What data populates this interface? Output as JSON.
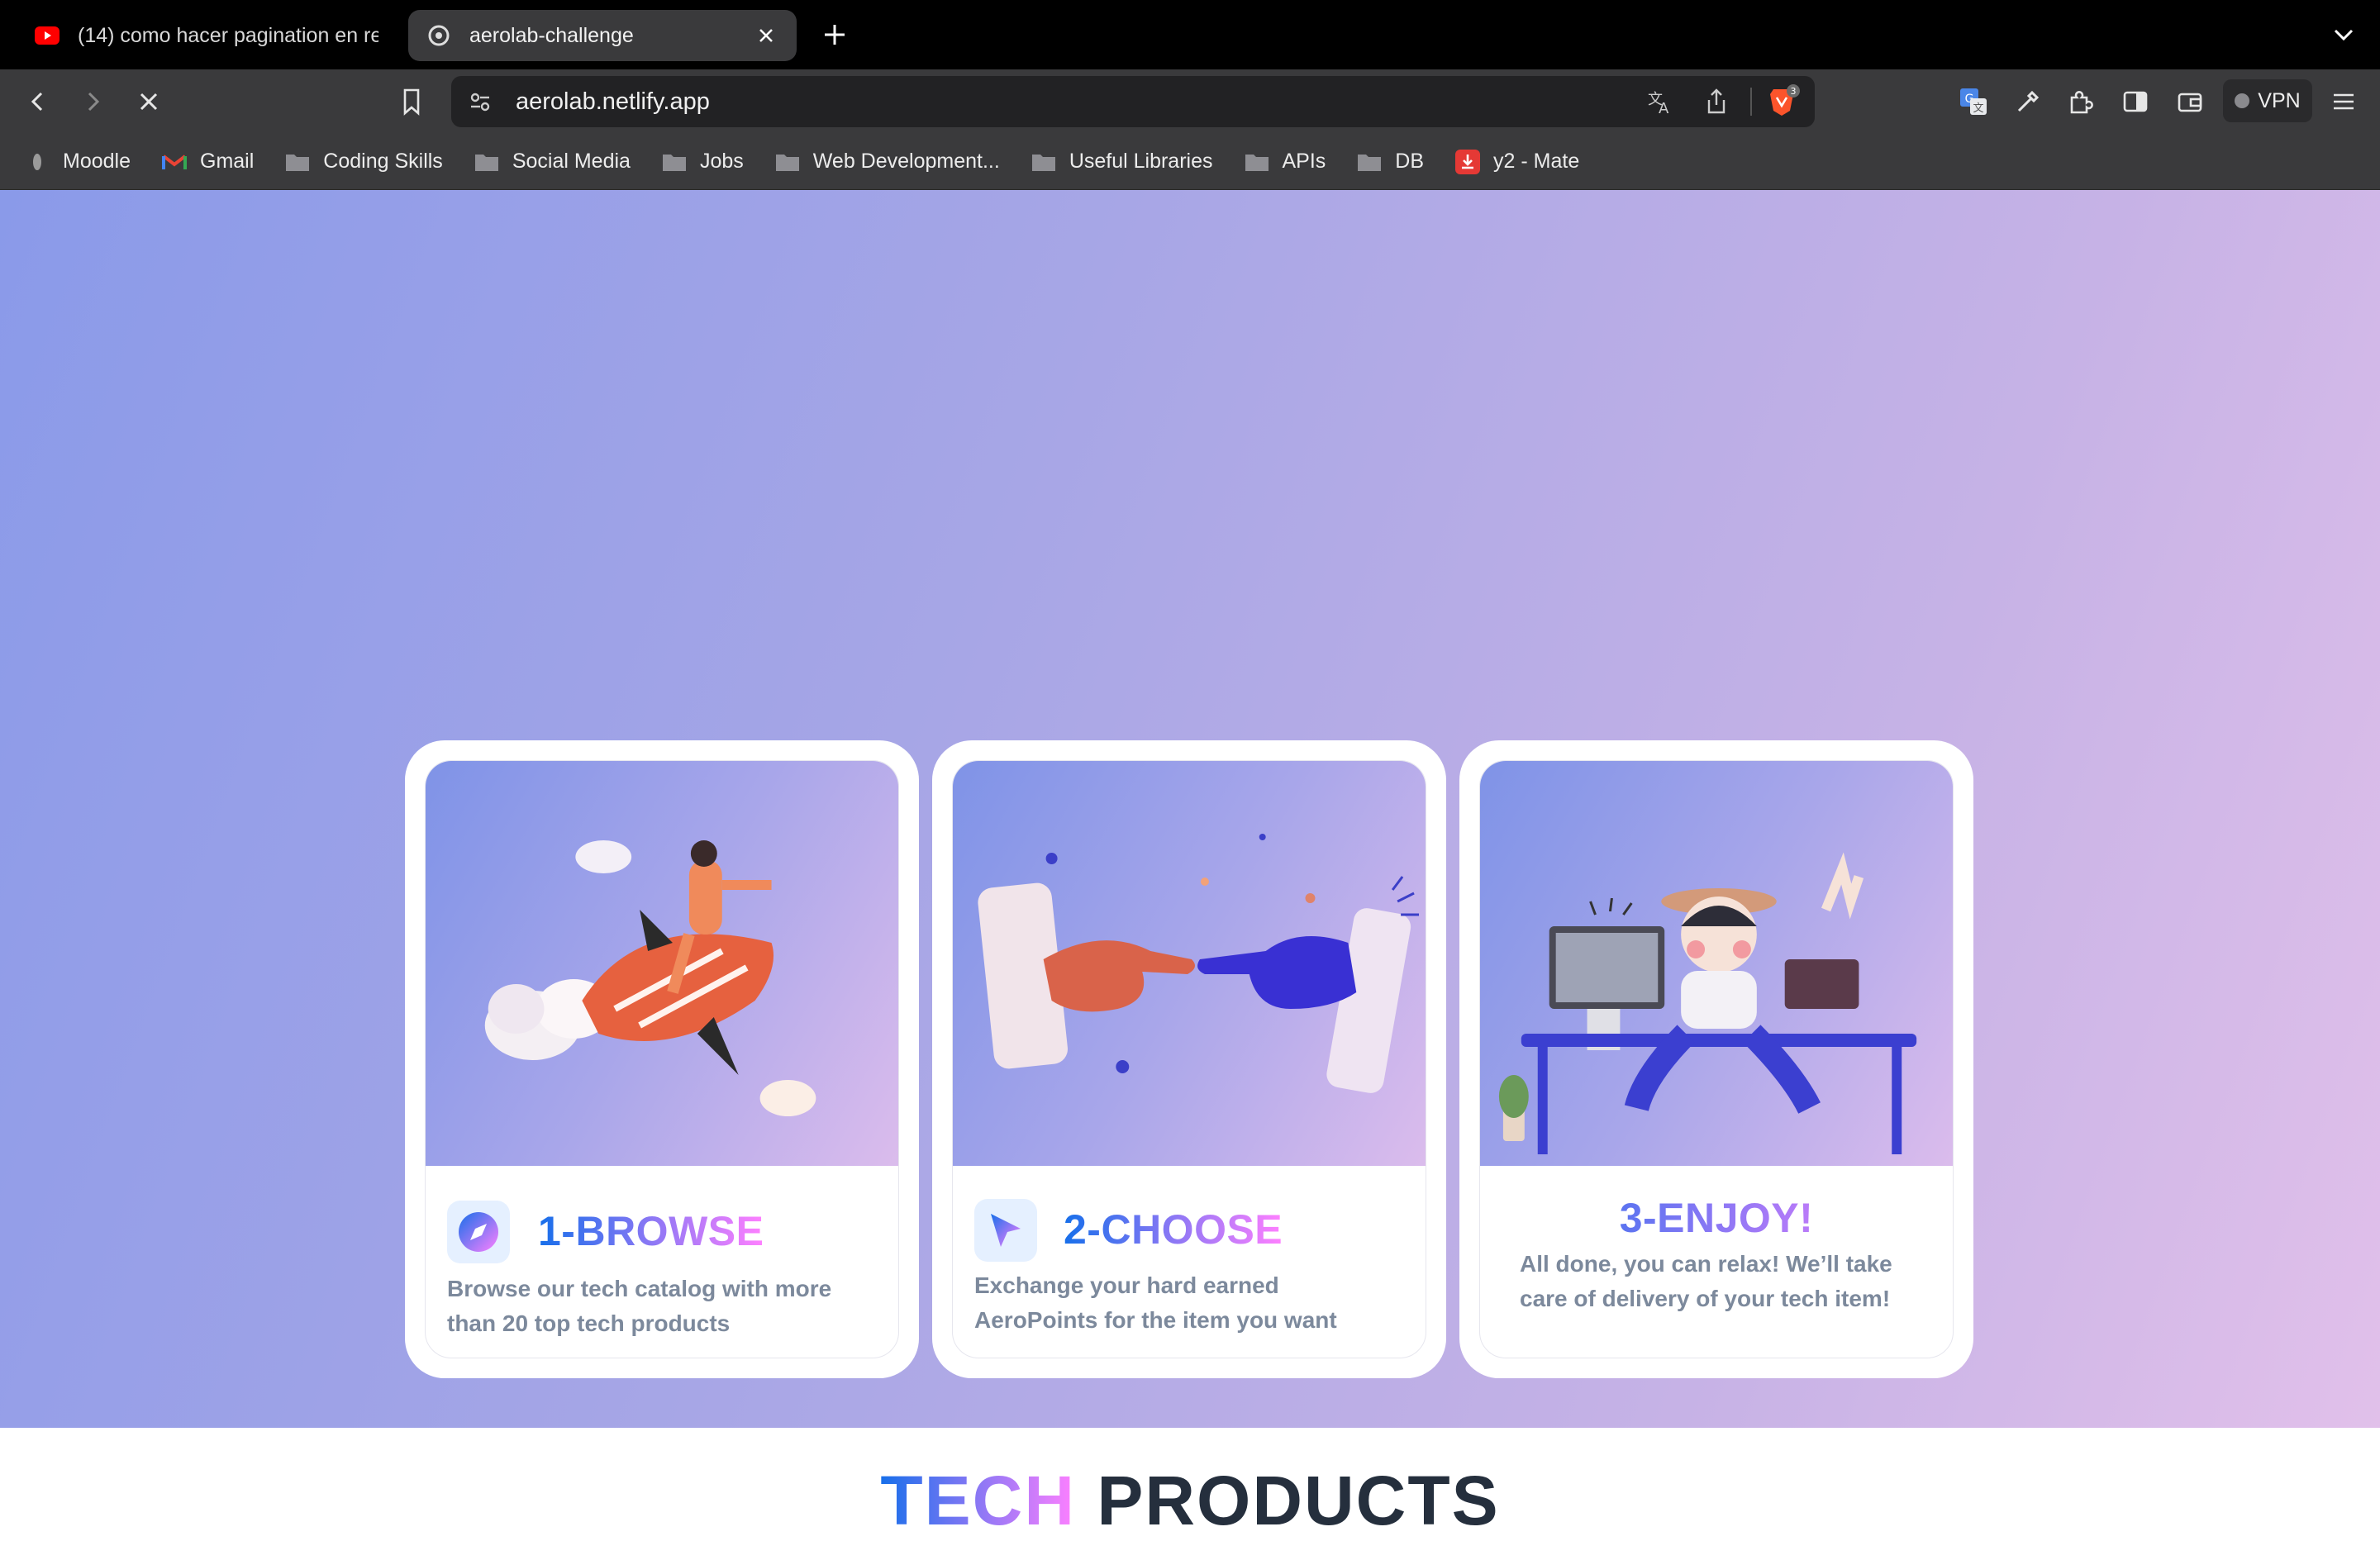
{
  "browser": {
    "tabs": [
      {
        "title": "(14) como hacer pagination en rea",
        "favicon": "youtube-icon",
        "active": false
      },
      {
        "title": "aerolab-challenge",
        "favicon": "site-icon",
        "active": true
      }
    ],
    "url": "aerolab.netlify.app",
    "vpn_label": "VPN",
    "shield_count": "3",
    "bookmarks": [
      {
        "label": "Moodle",
        "icon": "moodle-icon"
      },
      {
        "label": "Gmail",
        "icon": "gmail-icon"
      },
      {
        "label": "Coding Skills",
        "icon": "folder-icon"
      },
      {
        "label": "Social Media",
        "icon": "folder-icon"
      },
      {
        "label": "Jobs",
        "icon": "folder-icon"
      },
      {
        "label": "Web Development...",
        "icon": "folder-icon"
      },
      {
        "label": "Useful Libraries",
        "icon": "folder-icon"
      },
      {
        "label": "APIs",
        "icon": "folder-icon"
      },
      {
        "label": "DB",
        "icon": "folder-icon"
      },
      {
        "label": "y2 - Mate",
        "icon": "download-icon"
      }
    ]
  },
  "steps": [
    {
      "title": "1-BROWSE",
      "description_lines": [
        "Browse our tech catalog with more",
        "than 20 top tech products"
      ],
      "icon": "compass-icon"
    },
    {
      "title": "2-CHOOSE",
      "description_lines": [
        "Exchange your hard earned",
        "AeroPoints for the item you want"
      ],
      "icon": "cursor-icon"
    },
    {
      "title": "3-ENJOY!",
      "description_lines": [
        "All done, you can relax! We’ll take",
        "care of delivery of your tech item!"
      ],
      "icon": ""
    }
  ],
  "section": {
    "title_highlight": "TECH",
    "title_rest": "PRODUCTS"
  },
  "colors": {
    "accent_start": "#176FEA",
    "accent_end": "#FF80FF",
    "hero_start": "#8A9AE9",
    "hero_end": "#E1C0EA"
  }
}
